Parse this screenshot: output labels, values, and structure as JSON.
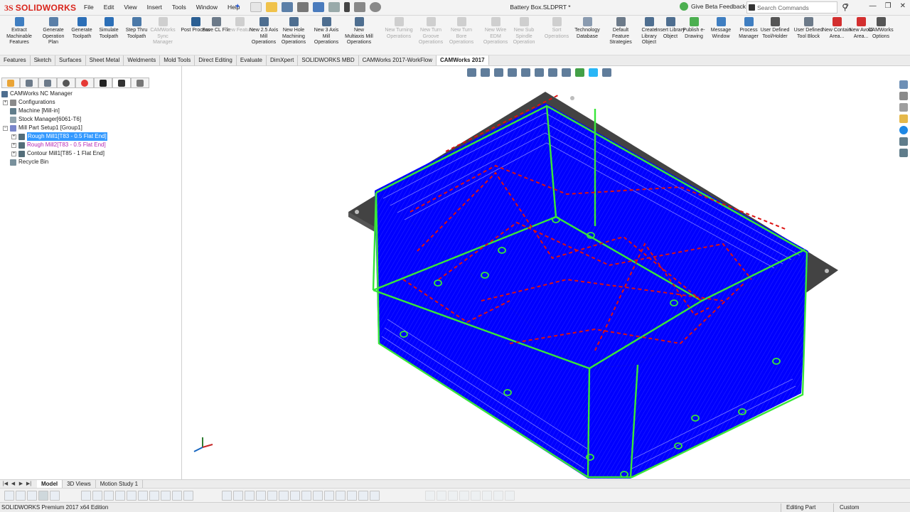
{
  "app": {
    "brand_ds": "3S",
    "brand_name": "SOLIDWORKS",
    "document_title": "Battery Box.SLDPRT *"
  },
  "menu": [
    "File",
    "Edit",
    "View",
    "Insert",
    "Tools",
    "Window",
    "Help"
  ],
  "top_right": {
    "feedback": "Give Beta Feedback",
    "search_placeholder": "Search Commands",
    "help": "?"
  },
  "ribbon": [
    {
      "label": "Extract Machinable Features",
      "enabled": true
    },
    {
      "label": "Generate Operation Plan",
      "enabled": true
    },
    {
      "label": "Generate Toolpath",
      "enabled": true
    },
    {
      "label": "Simulate Toolpath",
      "enabled": true
    },
    {
      "label": "Step Thru Toolpath",
      "enabled": true
    },
    {
      "label": "CAMWorks Sync Manager",
      "enabled": false
    },
    {
      "label": "Post Process",
      "enabled": true
    },
    {
      "label": "Save CL File",
      "enabled": true
    },
    {
      "label": "New Feature",
      "enabled": false
    },
    {
      "label": "New 2.5 Axis Mill Operations",
      "enabled": true
    },
    {
      "label": "New Hole Machining Operations",
      "enabled": true
    },
    {
      "label": "New 3 Axis Mill Operations",
      "enabled": true
    },
    {
      "label": "New Multiaxis Mill Operations",
      "enabled": true
    },
    {
      "label": "New Turning Operations",
      "enabled": false
    },
    {
      "label": "New Turn Groove Operations",
      "enabled": false
    },
    {
      "label": "New Turn Bore Operations",
      "enabled": false
    },
    {
      "label": "New Wire EDM Operations",
      "enabled": false
    },
    {
      "label": "New Sub Spindle Operation",
      "enabled": false
    },
    {
      "label": "Sort Operations",
      "enabled": false
    },
    {
      "label": "Technology Database",
      "enabled": true
    },
    {
      "label": "Default Feature Strategies",
      "enabled": true
    },
    {
      "label": "Create Library Object",
      "enabled": true
    },
    {
      "label": "Insert Library Object",
      "enabled": true
    },
    {
      "label": "Publish e-Drawing",
      "enabled": true
    },
    {
      "label": "Message Window",
      "enabled": true
    },
    {
      "label": "Process Manager",
      "enabled": true
    },
    {
      "label": "User Defined Tool/Holder",
      "enabled": true
    },
    {
      "label": "User Defined Tool Block",
      "enabled": true
    },
    {
      "label": "New Contain Area...",
      "enabled": true
    },
    {
      "label": "New Avoid Area...",
      "enabled": true
    },
    {
      "label": "CAMWorks Options",
      "enabled": true
    }
  ],
  "tabs": [
    "Features",
    "Sketch",
    "Surfaces",
    "Sheet Metal",
    "Weldments",
    "Mold Tools",
    "Direct Editing",
    "Evaluate",
    "DimXpert",
    "SOLIDWORKS MBD",
    "CAMWorks 2017-WorkFlow",
    "CAMWorks 2017"
  ],
  "active_tab": "CAMWorks 2017",
  "tree": {
    "root": "CAMWorks NC Manager",
    "items": [
      "Configurations",
      "Machine [Mill-in]",
      "Stock Manager[6061-T6]",
      "Mill Part Setup1 [Group1]",
      "Rough Mill1[T83 - 0.5 Flat End]",
      "Rough Mill2[T83 - 0.5 Flat End]",
      "Contour Mill1[T85 - 1 Flat End]",
      "Recycle Bin"
    ]
  },
  "bottom_tabs": [
    "Model",
    "3D Views",
    "Motion Study 1"
  ],
  "status": {
    "edition": "SOLIDWORKS Premium 2017 x64 Edition",
    "mode": "Editing Part",
    "units": "Custom"
  },
  "colors": {
    "toolpath_blue": "#0000ff",
    "contour_green": "#39e639",
    "rapid_red": "#dd1111",
    "selection": "#3399ff"
  }
}
